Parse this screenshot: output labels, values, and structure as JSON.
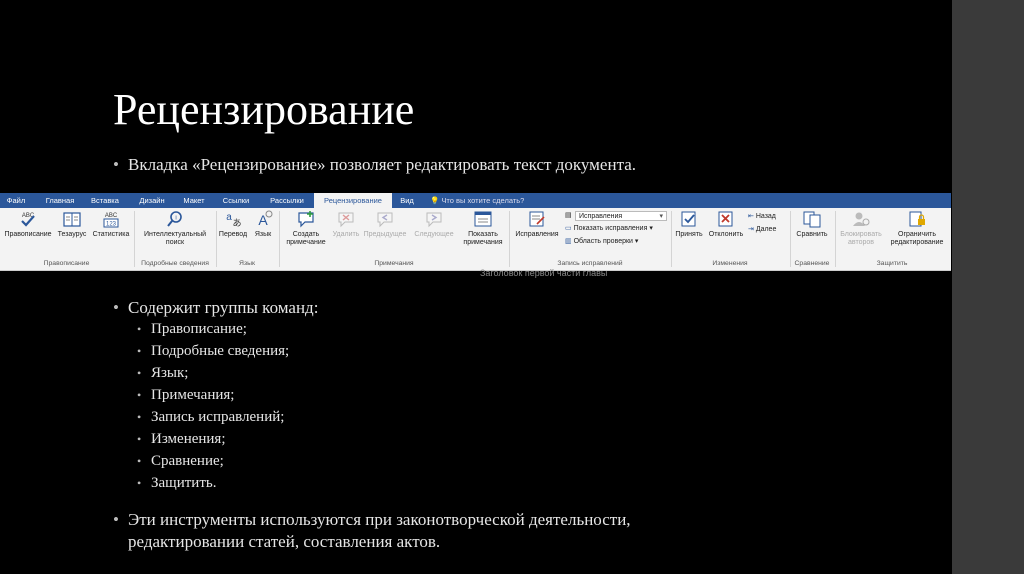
{
  "slide": {
    "title": "Рецензирование",
    "intro_bullet": "Вкладка «Рецензирование» позволяет редактировать текст документа.",
    "groups_bullet": "Содержит группы команд:",
    "group_items": [
      "Правописание;",
      "Подробные сведения;",
      "Язык;",
      "Примечания;",
      "Запись исправлений;",
      "Изменения;",
      "Сравнение;",
      "Защитить."
    ],
    "tools_bullet_line1": "Эти инструменты используются при законотворческой деятельности,",
    "tools_bullet_line2": "редактировании статей, составления актов.",
    "bullet_glyph": "•"
  },
  "ribbon": {
    "tabs": [
      "Файл",
      "Главная",
      "Вставка",
      "Дизайн",
      "Макет",
      "Ссылки",
      "Рассылки",
      "Рецензирование",
      "Вид"
    ],
    "active_tab": "Рецензирование",
    "tell_me": "Что вы хотите сделать?",
    "buttons": {
      "spelling": "Правописание",
      "thesaurus": "Тезаурус",
      "statistics": "Статистика",
      "smart_lookup_1": "Интеллектуальный",
      "smart_lookup_2": "поиск",
      "translate": "Перевод",
      "language": "Язык",
      "new_comment_1": "Создать",
      "new_comment_2": "примечание",
      "delete": "Удалить",
      "previous": "Предыдущее",
      "next": "Следующее",
      "show_comments_1": "Показать",
      "show_comments_2": "примечания",
      "track_changes": "Исправления",
      "markup_select": "Исправления",
      "show_markup": "Показать исправления",
      "review_pane": "Область проверки",
      "accept": "Принять",
      "reject": "Отклонить",
      "prev_change": "Назад",
      "next_change": "Далее",
      "compare": "Сравнить",
      "block_authors_1": "Блокировать",
      "block_authors_2": "авторов",
      "restrict_1": "Ограничить",
      "restrict_2": "редактирование"
    },
    "group_labels": {
      "proofing": "Правописание",
      "insights": "Подробные сведения",
      "language": "Язык",
      "comments": "Примечания",
      "tracking": "Запись исправлений",
      "changes": "Изменения",
      "compare": "Сравнение",
      "protect": "Защитить"
    },
    "icon_text": {
      "abc": "ABC",
      "num": "123"
    },
    "behind_text": "Заголовок первой части главы",
    "colors": {
      "tabbar": "#2b579a",
      "ribbon_bg": "#f3f3f3",
      "accent_blue": "#2b579a"
    }
  }
}
